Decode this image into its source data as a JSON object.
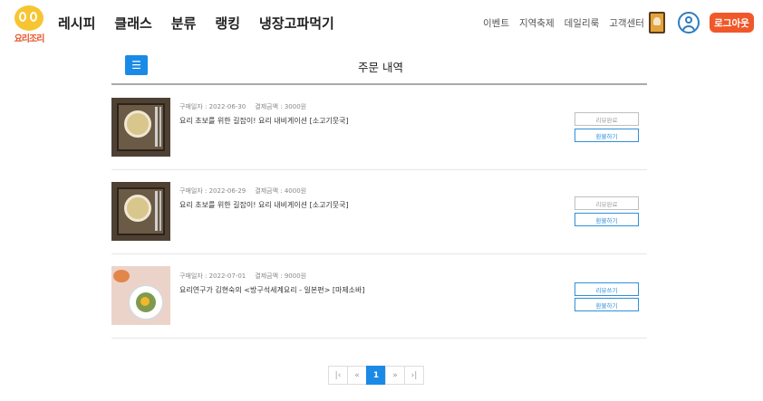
{
  "brand": {
    "logo_text": "요리조리"
  },
  "main_nav": [
    "레시피",
    "클래스",
    "분류",
    "랭킹",
    "냉장고파먹기"
  ],
  "util_nav": [
    "이벤트",
    "지역축제",
    "데일리룩",
    "고객센터"
  ],
  "header": {
    "logout_label": "로그아웃"
  },
  "page": {
    "title": "주문 내역",
    "menu_icon": "☰"
  },
  "labels": {
    "purchase_date": "구매일자 : ",
    "payment_amount": "결제금액 : ",
    "currency_suffix": "원"
  },
  "orders": [
    {
      "date": "2022-06-30",
      "amount": "3000",
      "title": "요리 초보를 위한 길잡이! 요리 내비게이션 [소고기뭇국]",
      "buttons": [
        "리뷰완료",
        "환불하기"
      ],
      "thumbnail": "beef-radish-soup-photo"
    },
    {
      "date": "2022-06-29",
      "amount": "4000",
      "title": "요리 초보를 위한 길잡이! 요리 내비게이션 [소고기뭇국]",
      "buttons": [
        "리뷰완료",
        "환불하기"
      ],
      "thumbnail": "beef-radish-soup-photo"
    },
    {
      "date": "2022-07-01",
      "amount": "9000",
      "title": "요리연구가 김현숙의 <방구석세계요리 - 일본편> [마제소바]",
      "buttons": [
        "리뷰쓰기",
        "환불하기"
      ],
      "thumbnail": "mazesoba-photo"
    }
  ],
  "pagination": {
    "first": "|‹",
    "prev": "«",
    "current": "1",
    "next": "»",
    "last": "›|"
  },
  "colors": {
    "accent_blue": "#1a8ae6",
    "logout_orange": "#f0582a",
    "logo_yellow": "#f6c531"
  }
}
